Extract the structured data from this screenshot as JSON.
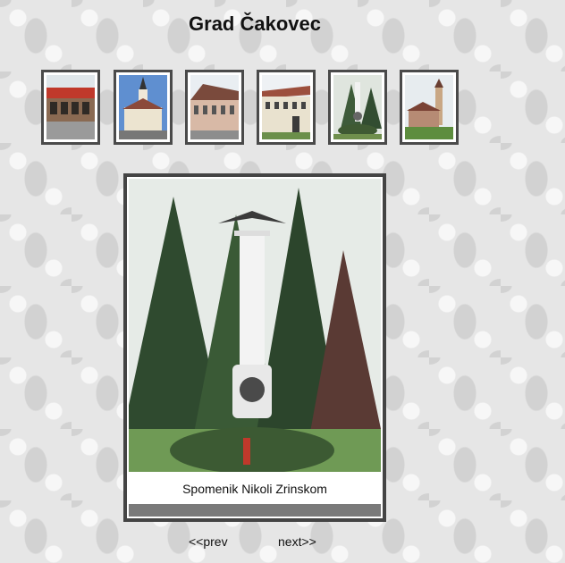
{
  "header": {
    "title": "Grad Čakovec"
  },
  "gallery": {
    "thumbnails": [
      {
        "subject": "modern-building-photo"
      },
      {
        "subject": "church-photo"
      },
      {
        "subject": "castle-photo"
      },
      {
        "subject": "palace-photo"
      },
      {
        "subject": "monument-photo"
      },
      {
        "subject": "chapel-photo"
      }
    ],
    "current": {
      "caption": "Spomenik Nikoli Zrinskom",
      "index": 5
    }
  },
  "nav": {
    "prev_label": "<<prev",
    "next_label": "next>>"
  },
  "colors": {
    "frame": "#444444",
    "background": "#e6e6e6",
    "text": "#111111"
  }
}
